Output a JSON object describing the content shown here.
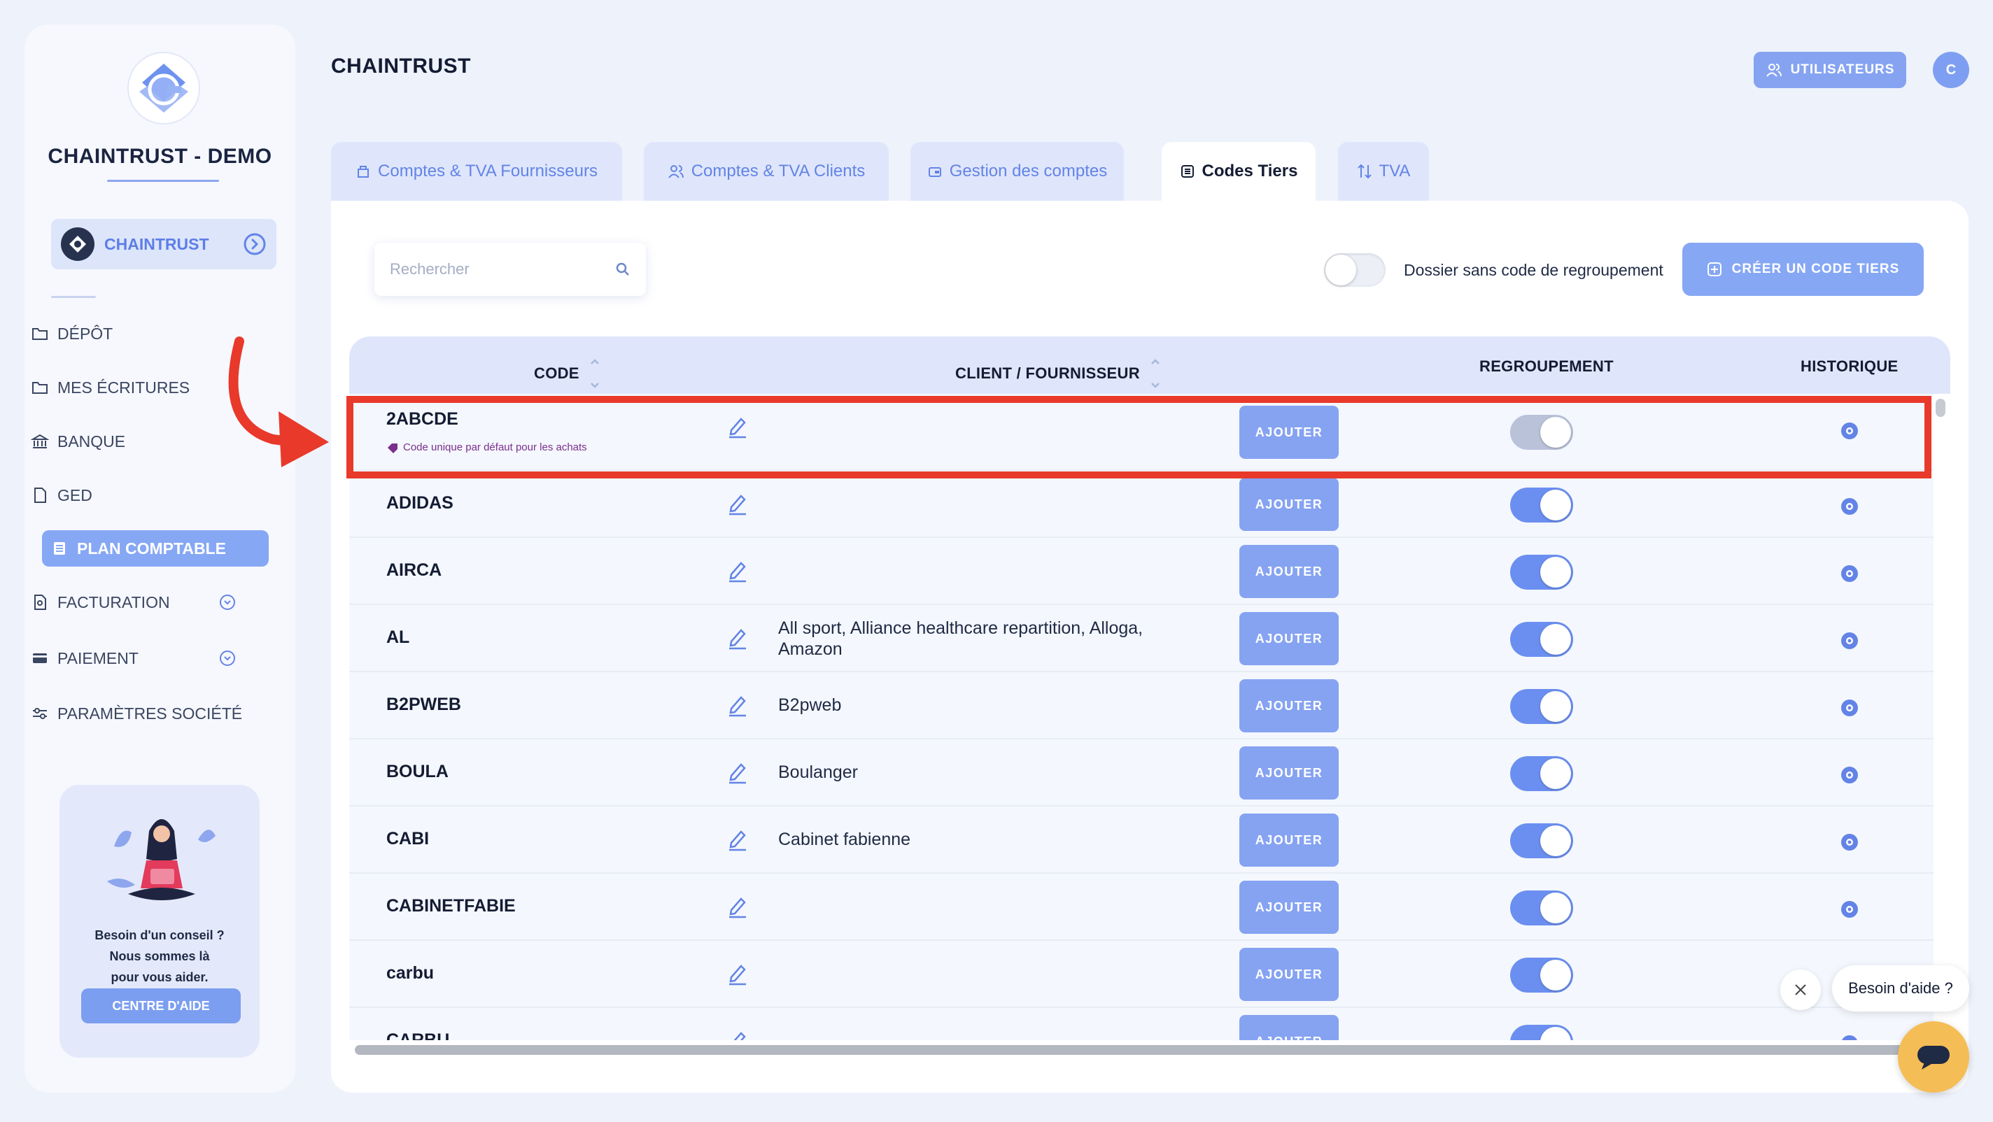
{
  "sidebar": {
    "brand": "CHAINTRUST - DEMO",
    "company": "CHAINTRUST",
    "items": [
      {
        "label": "DÉPÔT"
      },
      {
        "label": "MES ÉCRITURES"
      },
      {
        "label": "BANQUE"
      },
      {
        "label": "GED"
      },
      {
        "label": "PLAN COMPTABLE"
      },
      {
        "label": "FACTURATION"
      },
      {
        "label": "PAIEMENT"
      },
      {
        "label": "PARAMÈTRES SOCIÉTÉ"
      }
    ],
    "help_card": {
      "line1": "Besoin d'un conseil ?",
      "line2": "Nous sommes là",
      "line3": "pour vous aider.",
      "button": "CENTRE D'AIDE"
    }
  },
  "header": {
    "title": "CHAINTRUST",
    "users_button": "UTILISATEURS",
    "avatar_letter": "C"
  },
  "tabs": [
    {
      "label": "Comptes & TVA Fournisseurs"
    },
    {
      "label": "Comptes & TVA Clients"
    },
    {
      "label": "Gestion des comptes"
    },
    {
      "label": "Codes Tiers"
    },
    {
      "label": "TVA"
    }
  ],
  "toolbar": {
    "search_placeholder": "Rechercher",
    "toggle_label": "Dossier sans code de regroupement",
    "create_button": "CRÉER UN CODE TIERS"
  },
  "table": {
    "columns": {
      "code": "CODE",
      "client": "CLIENT / FOURNISSEUR",
      "regroupement": "REGROUPEMENT",
      "historique": "HISTORIQUE"
    },
    "add_label": "AJOUTER",
    "rows": [
      {
        "code": "2ABCDE",
        "note": "Code unique par défaut pour les achats",
        "client": "",
        "regroupement": false
      },
      {
        "code": "ADIDAS",
        "client": "",
        "regroupement": true
      },
      {
        "code": "AIRCA",
        "client": "",
        "regroupement": true
      },
      {
        "code": "AL",
        "client": "All sport, Alliance healthcare repartition, Alloga,",
        "client2": "Amazon",
        "regroupement": true
      },
      {
        "code": "B2PWEB",
        "client": "B2pweb",
        "regroupement": true
      },
      {
        "code": "BOULA",
        "client": "Boulanger",
        "regroupement": true
      },
      {
        "code": "CABI",
        "client": "Cabinet fabienne",
        "regroupement": true
      },
      {
        "code": "CABINETFABIE",
        "client": "",
        "regroupement": true
      },
      {
        "code": "carbu",
        "client": "",
        "regroupement": true
      },
      {
        "code": "CARBU",
        "client": "",
        "regroupement": true
      }
    ]
  },
  "chat": {
    "bubble": "Besoin d'aide ?"
  }
}
